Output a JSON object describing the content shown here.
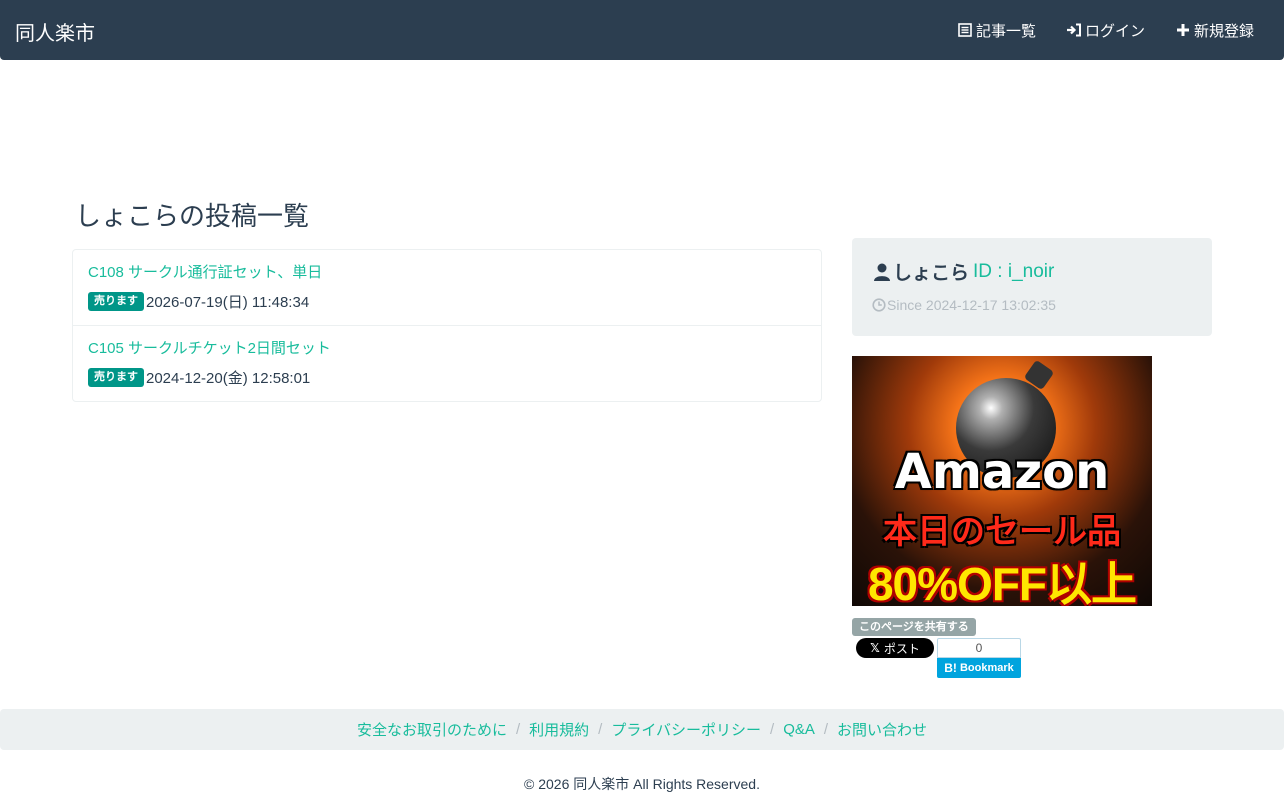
{
  "navbar": {
    "brand": "同人楽市",
    "items": [
      {
        "label": "記事一覧",
        "icon": "list-icon"
      },
      {
        "label": "ログイン",
        "icon": "login-icon"
      },
      {
        "label": "新規登録",
        "icon": "plus-icon"
      }
    ]
  },
  "page": {
    "title": "しょこらの投稿一覧"
  },
  "posts": [
    {
      "title": "C108 サークル通行証セット、単日",
      "badge": "売ります",
      "datetime": "2026-07-19(日) 11:48:34"
    },
    {
      "title": "C105 サークルチケット2日間セット",
      "badge": "売ります",
      "datetime": "2024-12-20(金) 12:58:01"
    }
  ],
  "profile": {
    "name": "しょこら",
    "id_text": "ID : i_noir",
    "since": "Since 2024-12-17 13:02:35"
  },
  "ad": {
    "line1": "Amazon",
    "line2": "本日のセール品",
    "line3": "80%OFF以上"
  },
  "share": {
    "label": "このページを共有する",
    "x_label": "ポスト",
    "x_mark": "𝕏",
    "hatena_count": "0",
    "hatena_mark": "B!",
    "hatena_label": "Bookmark"
  },
  "footer": {
    "links": [
      "安全なお取引のために",
      "利用規約",
      "プライバシーポリシー",
      "Q&A",
      "お問い合わせ"
    ],
    "separator": "/",
    "copyright": "© 2026 同人楽市 All Rights Reserved."
  },
  "colors": {
    "navbar": "#2c3e50",
    "accent": "#18bc9c",
    "badge": "#009688",
    "panel": "#ecf0f1"
  }
}
